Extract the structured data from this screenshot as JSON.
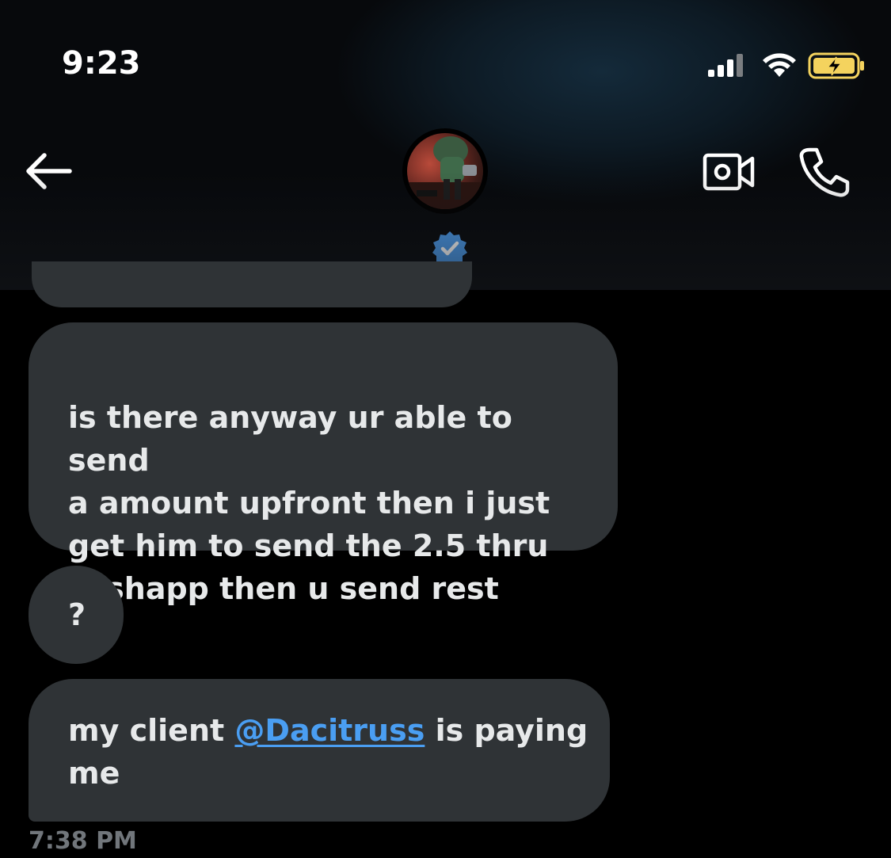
{
  "status_bar": {
    "time": "9:23",
    "icons": [
      "signal-icon",
      "wifi-icon",
      "battery-charging-icon"
    ],
    "battery_color": "#f4d35e"
  },
  "header": {
    "back_icon": "arrow-left-icon",
    "avatar": "profile-avatar",
    "verified_icon": "verified-badge-icon",
    "verified_color": "#4a99e9",
    "actions": [
      "video-camera-icon",
      "phone-icon"
    ]
  },
  "messages": [
    {
      "text": "is there anyway ur able to send\na amount upfront then i just\nget him to send the 2.5 thru\ncashapp then u send rest"
    },
    {
      "text": "?"
    },
    {
      "text_before": "my client ",
      "mention": "@Dacitruss",
      "text_after": " is paying\nme"
    }
  ],
  "last_message_time": "7:38 PM",
  "colors": {
    "bubble": "#2f3336",
    "mention": "#4a9ef2",
    "timestamp": "#71767b"
  }
}
